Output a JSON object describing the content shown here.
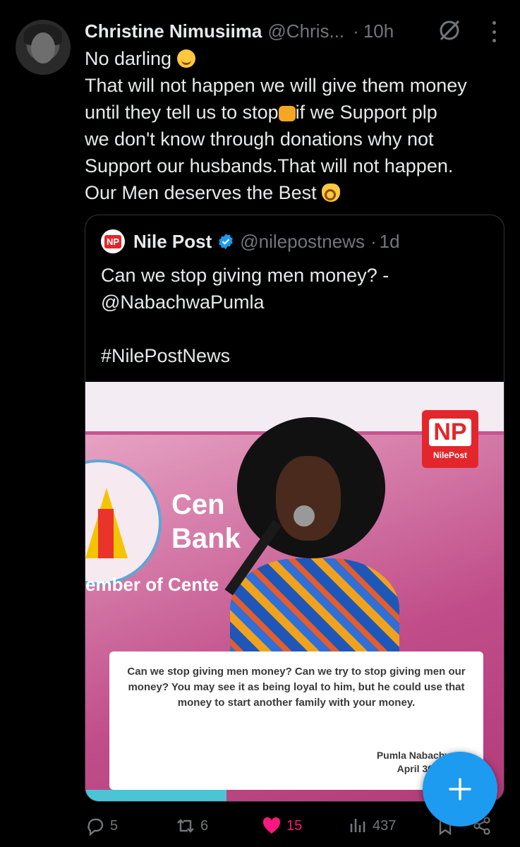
{
  "tweet": {
    "author_name": "Christine Nimusiima",
    "author_handle": "@Chris...",
    "separator": "·",
    "time": "10h",
    "lines": [
      "No darling",
      "That will not happen we will give them money",
      "until they tell us to stop",
      "if we  Support plp",
      "we don't know through donations why not",
      "Support our husbands.That will not happen.",
      "Our Men deserves the Best"
    ]
  },
  "quote": {
    "author_name": "Nile Post",
    "author_handle": "@nilepostnews",
    "separator": "·",
    "time": "1d",
    "logo_text": "NP",
    "text_line1": "Can we stop giving men money? -",
    "text_line2": "@NabachwaPumla",
    "hashtag": "#NilePostNews",
    "image": {
      "logo_text": "NP",
      "logo_label": "NilePost",
      "bank_line1": "Cen",
      "bank_line2": "Bank",
      "member_text": "ember of Cente",
      "caption": "Can we stop giving men money? Can we try to stop giving men our money? You may see it as being loyal to him, but he could use that money to start another family with your money.",
      "caption_author": "Pumla Nabachwa",
      "caption_date": "April 30 2026"
    }
  },
  "actions": {
    "replies": "5",
    "reposts": "6",
    "likes": "15",
    "views": "437"
  },
  "colors": {
    "background": "#000000",
    "text": "#e7e9ea",
    "muted": "#71767b",
    "like": "#f91880",
    "accent": "#1d9bf0",
    "nilepost_red": "#e3262b"
  },
  "icons": [
    "grok-icon",
    "more-icon",
    "verified-icon",
    "reply-icon",
    "repost-icon",
    "like-icon",
    "views-icon",
    "bookmark-icon",
    "share-icon",
    "compose-icon"
  ]
}
